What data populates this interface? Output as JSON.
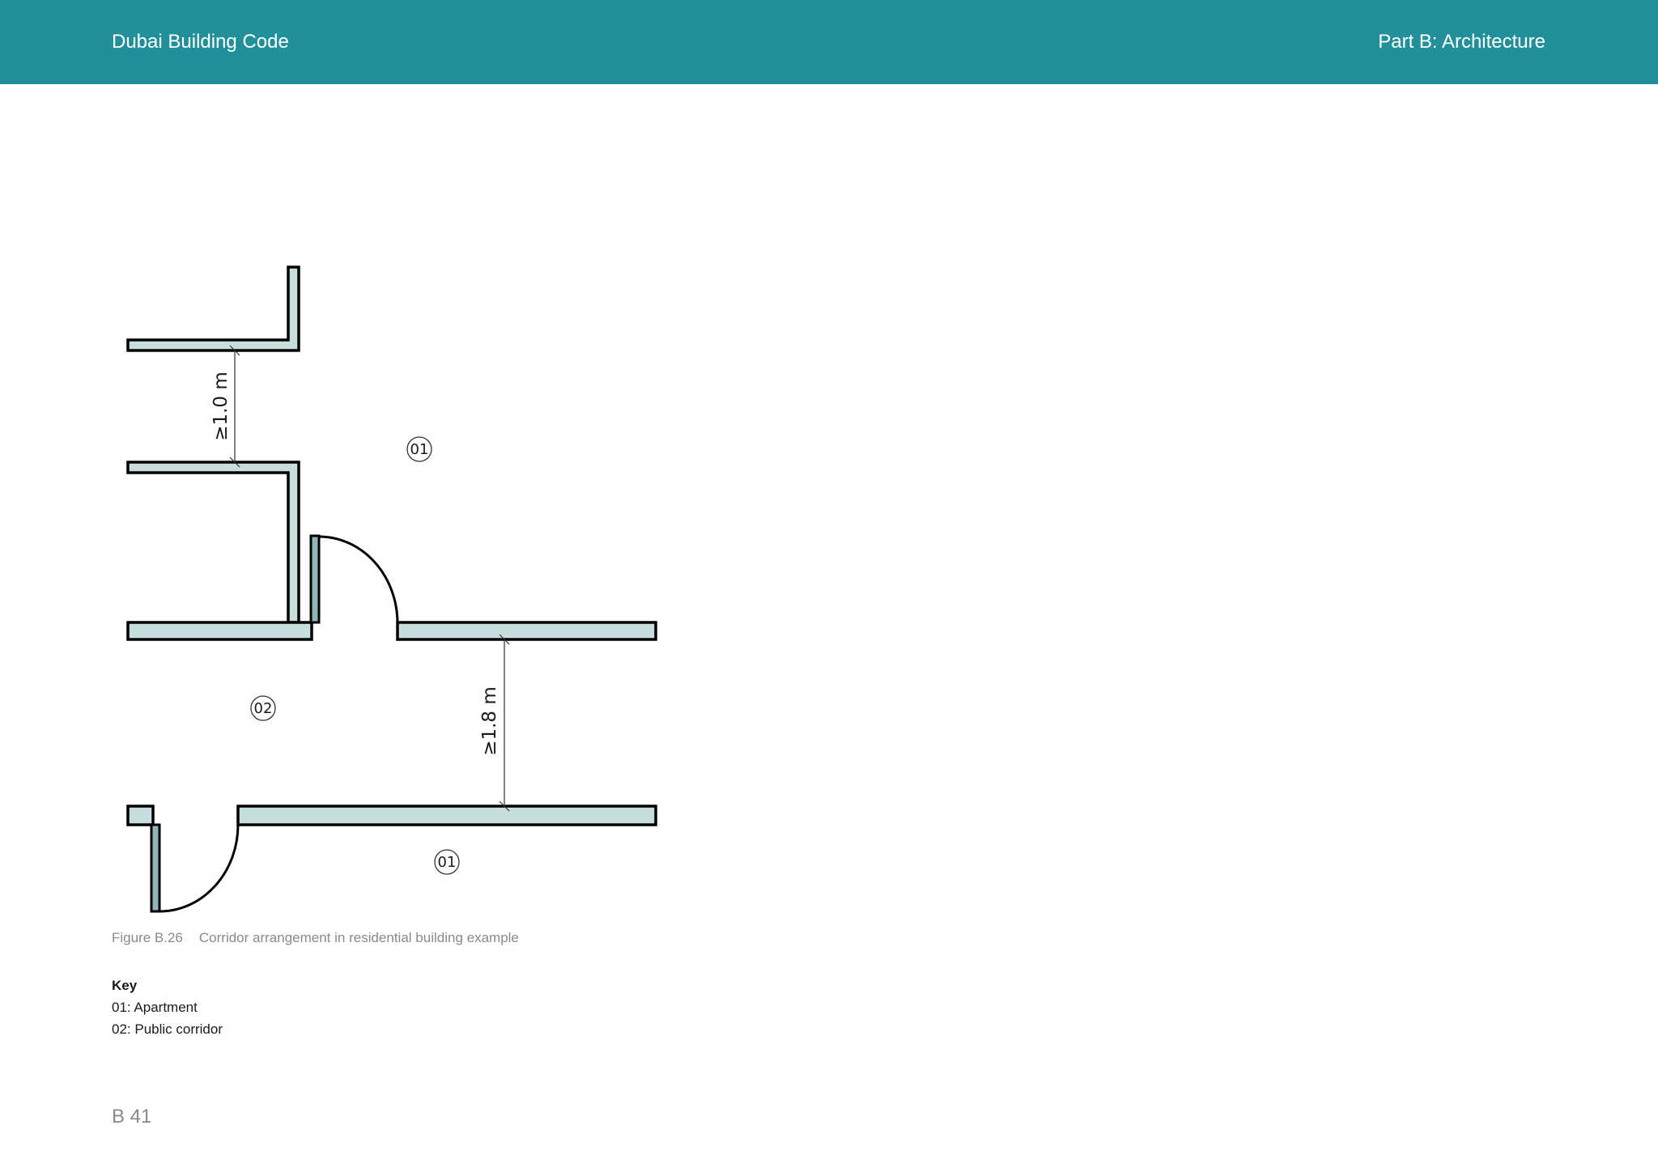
{
  "header": {
    "left_title": "Dubai Building Code",
    "right_title": "Part B: Architecture",
    "background_color": "#22909a"
  },
  "figure": {
    "dimensions": {
      "top": "≥1.0 m",
      "middle": "≥1.8 m"
    },
    "labels": {
      "apartment_upper": "01",
      "corridor": "02",
      "apartment_lower": "01"
    },
    "wall_color": "#c8dedd",
    "door_color": "#8fb6b8"
  },
  "caption": {
    "number": "Figure B.26",
    "text": "Corridor arrangement in residential building example"
  },
  "key": {
    "title": "Key",
    "items": [
      "01: Apartment",
      "02: Public corridor"
    ]
  },
  "page_number": "B 41"
}
